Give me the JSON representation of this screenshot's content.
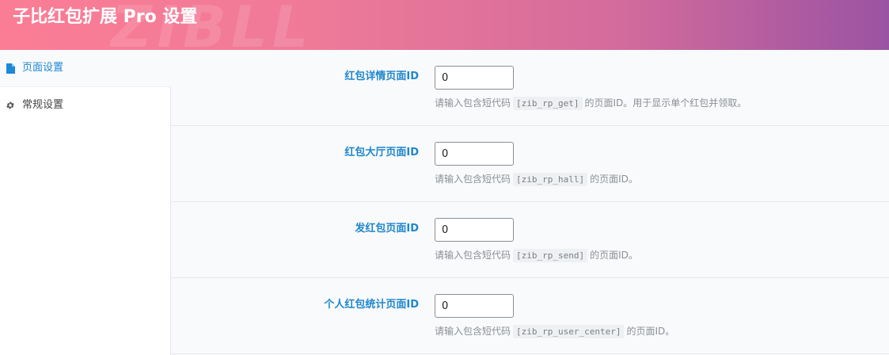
{
  "header": {
    "title": "子比红包扩展 Pro 设置",
    "watermark": "ZIBLL"
  },
  "sidebar": {
    "items": [
      {
        "label": "页面设置",
        "icon": "file-icon",
        "active": true
      },
      {
        "label": "常规设置",
        "icon": "gear-icon",
        "active": false
      }
    ]
  },
  "fields": [
    {
      "label": "红包详情页面ID",
      "value": "0",
      "desc_before": "请输入包含短代码",
      "shortcode": "[zib_rp_get]",
      "desc_after": "的页面ID。用于显示单个红包并领取。"
    },
    {
      "label": "红包大厅页面ID",
      "value": "0",
      "desc_before": "请输入包含短代码",
      "shortcode": "[zib_rp_hall]",
      "desc_after": "的页面ID。"
    },
    {
      "label": "发红包页面ID",
      "value": "0",
      "desc_before": "请输入包含短代码",
      "shortcode": "[zib_rp_send]",
      "desc_after": "的页面ID。"
    },
    {
      "label": "个人红包统计页面ID",
      "value": "0",
      "desc_before": "请输入包含短代码",
      "shortcode": "[zib_rp_user_center]",
      "desc_after": "的页面ID。"
    }
  ],
  "colors": {
    "accent": "#1e88d6",
    "label": "#1f86cc",
    "header_start": "#fb7d95",
    "header_end": "#9a53a3"
  }
}
